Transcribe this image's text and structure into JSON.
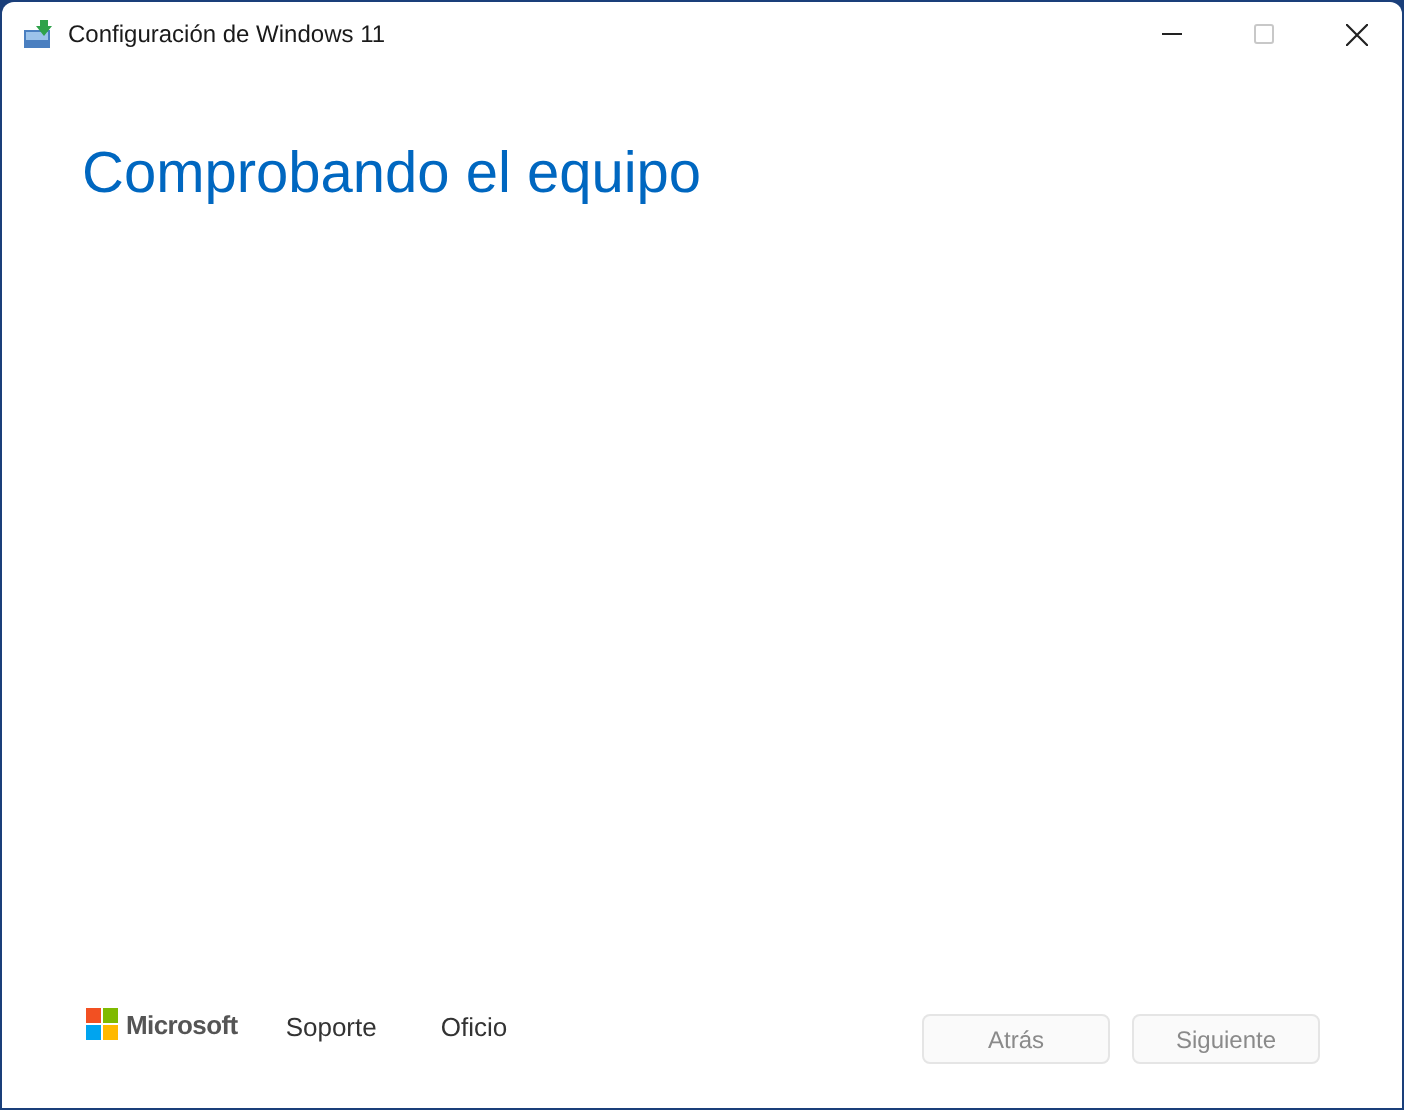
{
  "window": {
    "title": "Configuración de Windows 11",
    "controls": [
      {
        "kind": "minimize",
        "disabled": false
      },
      {
        "kind": "maximize",
        "disabled": true
      },
      {
        "kind": "close",
        "disabled": false
      }
    ]
  },
  "heading": "Comprobando el equipo",
  "footer": {
    "brand": "Microsoft",
    "links": [
      "Soporte",
      "Oficio"
    ]
  },
  "buttons": [
    {
      "label": "Atrás",
      "disabled": true
    },
    {
      "label": "Siguiente",
      "disabled": true
    }
  ]
}
